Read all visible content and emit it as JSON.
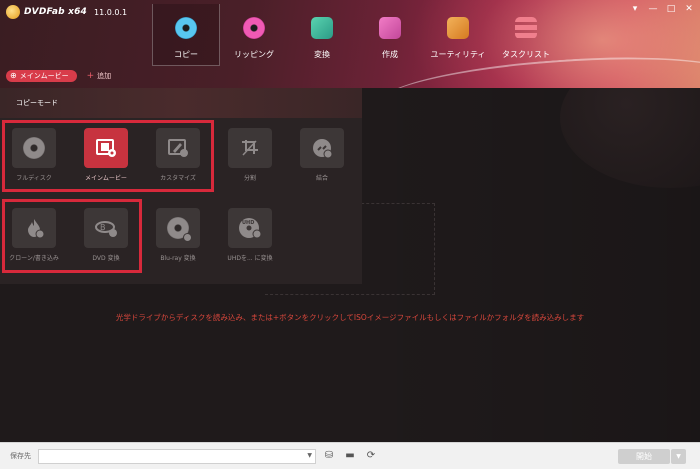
{
  "app": {
    "name": "DVDFab x64",
    "version": "11.0.0.1"
  },
  "window_controls": [
    "▾",
    "—",
    "□",
    "✕"
  ],
  "nav": [
    {
      "label": "コピー",
      "icon": "copy-disc-icon",
      "active": true
    },
    {
      "label": "リッピング",
      "icon": "ripper-icon",
      "active": false
    },
    {
      "label": "変換",
      "icon": "converter-icon",
      "active": false
    },
    {
      "label": "作成",
      "icon": "creator-icon",
      "active": false
    },
    {
      "label": "ユーティリティ",
      "icon": "utility-icon",
      "active": false
    },
    {
      "label": "タスクリスト",
      "icon": "task-list-icon",
      "active": false
    }
  ],
  "subnav": {
    "main_copy": "メインムービー",
    "add": "追加"
  },
  "copy_mode": {
    "header": "コピーモード",
    "modes": [
      {
        "label": "フルディスク",
        "icon": "disc-icon"
      },
      {
        "label": "メインムービー",
        "icon": "film-icon",
        "active": true
      },
      {
        "label": "カスタマイズ",
        "icon": "edit-icon"
      },
      {
        "label": "分割",
        "icon": "split-icon"
      },
      {
        "label": "結合",
        "icon": "merge-icon"
      },
      {
        "label": "クローン/書き込み",
        "icon": "burn-icon"
      },
      {
        "label": "DVD 変換",
        "icon": "bluray-to-dvd-icon"
      },
      {
        "label": "Blu-ray 変換",
        "icon": "dvd-to-bluray-icon"
      },
      {
        "label": "UHDを... に変換",
        "icon": "uhd-icon"
      }
    ]
  },
  "drop_hint": "光学ドライブからディスクを読み込み、または+ボタンをクリックしてISOイメージファイルもしくはファイルかフォルダを読み込みします",
  "footer": {
    "save_label": "保存先",
    "save_path": "",
    "start": "開始"
  },
  "colors": {
    "accent": "#c7333f",
    "highlight_box": "#d7293b",
    "hint_text": "#d8473c"
  }
}
